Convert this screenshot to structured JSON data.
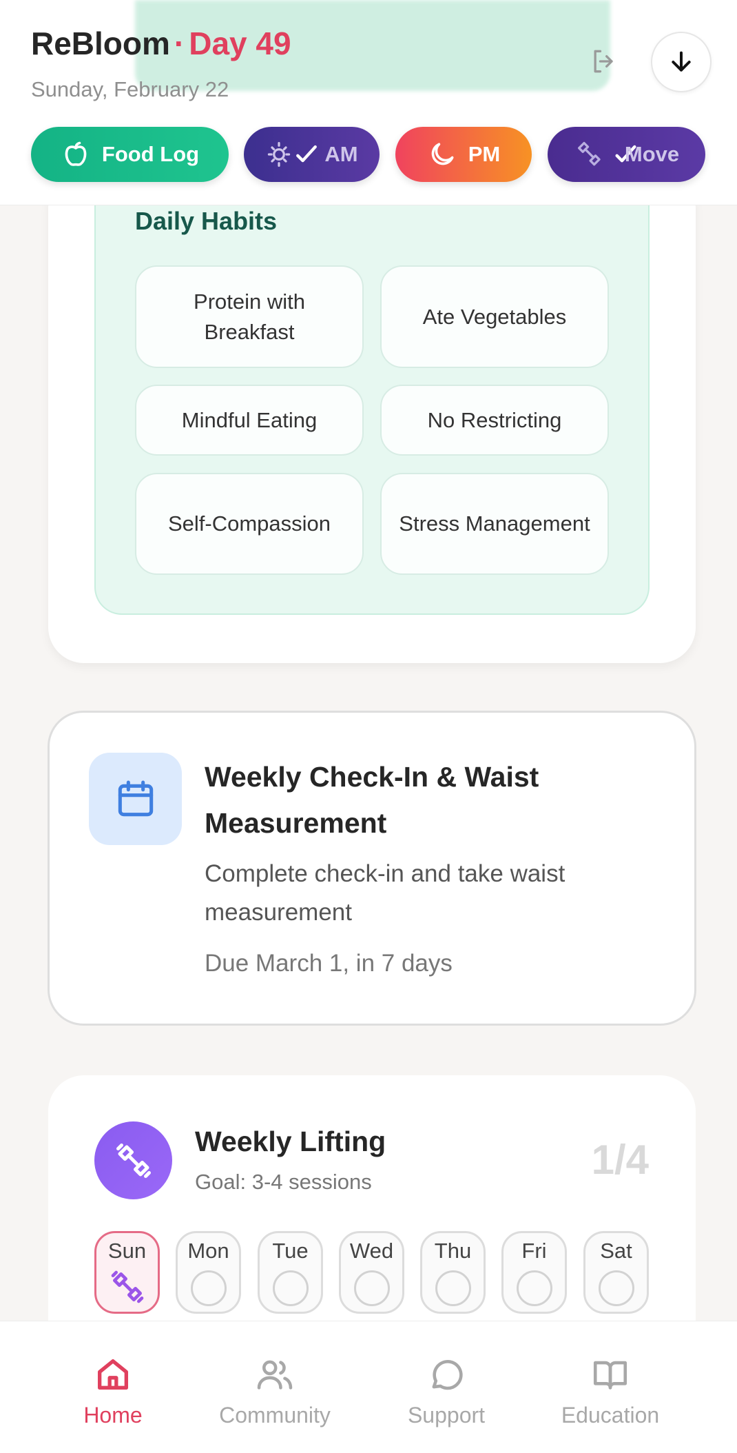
{
  "header": {
    "app_name": "ReBloom",
    "separator": "·",
    "day_label": "Day 49",
    "date": "Sunday, February 22",
    "logout_icon": "logout-icon",
    "download_icon": "arrow-down-icon"
  },
  "quick_actions": [
    {
      "label": "Food Log",
      "icon": "apple-icon"
    },
    {
      "label": "AM",
      "icon": "sun-check-icon"
    },
    {
      "label": "PM",
      "icon": "moon-icon"
    },
    {
      "label": "Move",
      "icon": "dumbbell-check-icon"
    }
  ],
  "daily_habits": {
    "title": "Daily Habits",
    "items": [
      {
        "label": "Protein with Breakfast"
      },
      {
        "label": "Ate Vegetables"
      },
      {
        "label": "Mindful Eating"
      },
      {
        "label": "No Restricting"
      },
      {
        "label": "Self-Compassion"
      },
      {
        "label": "Stress Management"
      }
    ]
  },
  "weekly_checkin": {
    "icon": "calendar-icon",
    "title": "Weekly Check-In & Waist Measurement",
    "description": "Complete check-in and take waist measurement",
    "due": "Due March 1, in 7 days"
  },
  "weekly_lifting": {
    "icon": "dumbbell-icon",
    "title": "Weekly Lifting",
    "goal": "Goal: 3-4 sessions",
    "count": "1/4",
    "days": [
      {
        "label": "Sun",
        "done": true
      },
      {
        "label": "Mon",
        "done": false
      },
      {
        "label": "Tue",
        "done": false
      },
      {
        "label": "Wed",
        "done": false
      },
      {
        "label": "Thu",
        "done": false
      },
      {
        "label": "Fri",
        "done": false
      },
      {
        "label": "Sat",
        "done": false
      }
    ]
  },
  "nav": {
    "items": [
      {
        "label": "Home",
        "icon": "home-icon",
        "active": true
      },
      {
        "label": "Community",
        "icon": "users-icon",
        "active": false
      },
      {
        "label": "Support",
        "icon": "chat-bubble-icon",
        "active": false
      },
      {
        "label": "Education",
        "icon": "book-icon",
        "active": false
      }
    ]
  },
  "colors": {
    "accent": "#e0405e",
    "food_green": "#14b385",
    "am_purple": "#3c2f8f",
    "pm_orange": "#f79224",
    "habit_panel": "#e7f8f1",
    "lifting_purple": "#8a5cf0"
  }
}
